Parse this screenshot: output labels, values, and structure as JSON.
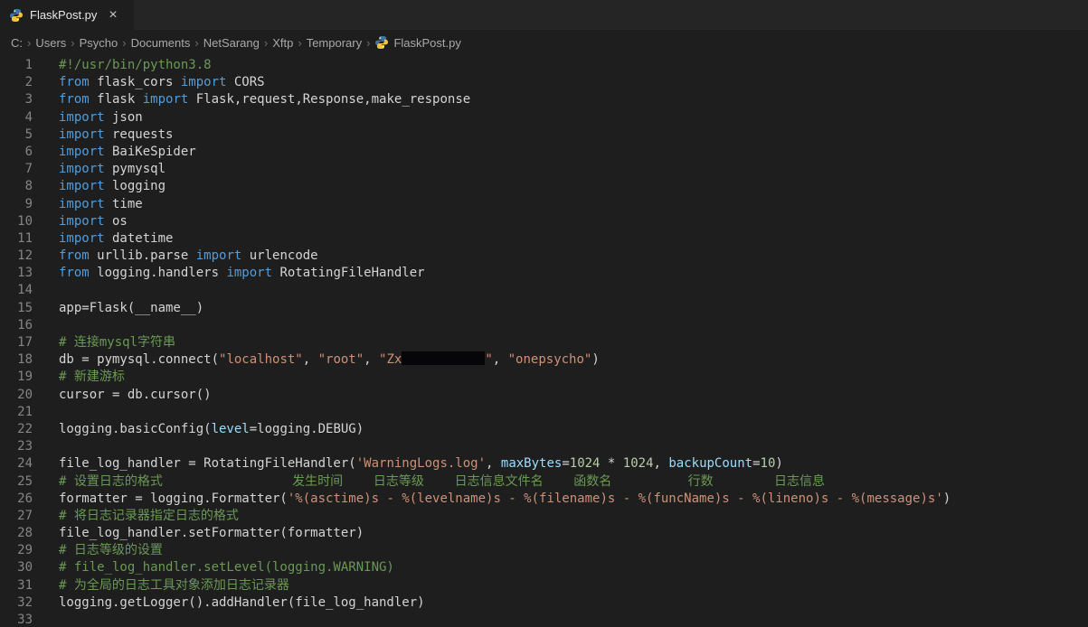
{
  "colors": {
    "editor_bg": "#1e1e1e",
    "tabbar_bg": "#252526",
    "tab_active_bg": "#1e1e1e",
    "tab_label": "#e7e7e7",
    "breadcrumb_text": "#a9a9a9",
    "line_number": "#858585",
    "plain": "#d4d4d4",
    "keyword": "#569cd6",
    "string": "#ce9178",
    "comment": "#6a9955",
    "number": "#b5cea8",
    "param": "#9cdcfe",
    "python_blue": "#3a74a6",
    "python_yellow": "#f0c33c",
    "redaction": "#060608"
  },
  "tab": {
    "label": "FlaskPost.py",
    "close": "×"
  },
  "breadcrumb": {
    "separator": "›",
    "items": [
      "C:",
      "Users",
      "Psycho",
      "Documents",
      "NetSarang",
      "Xftp",
      "Temporary"
    ],
    "file": "FlaskPost.py"
  },
  "editor": {
    "lines": [
      {
        "n": 1,
        "tokens": [
          [
            "cm",
            "#!/usr/bin/python3.8"
          ]
        ]
      },
      {
        "n": 2,
        "tokens": [
          [
            "kw",
            "from"
          ],
          [
            "pl",
            " flask_cors "
          ],
          [
            "kw",
            "import"
          ],
          [
            "pl",
            " CORS"
          ]
        ]
      },
      {
        "n": 3,
        "tokens": [
          [
            "kw",
            "from"
          ],
          [
            "pl",
            " flask "
          ],
          [
            "kw",
            "import"
          ],
          [
            "pl",
            " Flask,request,Response,make_response"
          ]
        ]
      },
      {
        "n": 4,
        "tokens": [
          [
            "kw",
            "import"
          ],
          [
            "pl",
            " json"
          ]
        ]
      },
      {
        "n": 5,
        "tokens": [
          [
            "kw",
            "import"
          ],
          [
            "pl",
            " requests"
          ]
        ]
      },
      {
        "n": 6,
        "tokens": [
          [
            "kw",
            "import"
          ],
          [
            "pl",
            " BaiKeSpider"
          ]
        ]
      },
      {
        "n": 7,
        "tokens": [
          [
            "kw",
            "import"
          ],
          [
            "pl",
            " pymysql"
          ]
        ]
      },
      {
        "n": 8,
        "tokens": [
          [
            "kw",
            "import"
          ],
          [
            "pl",
            " logging"
          ]
        ]
      },
      {
        "n": 9,
        "tokens": [
          [
            "kw",
            "import"
          ],
          [
            "pl",
            " time"
          ]
        ]
      },
      {
        "n": 10,
        "tokens": [
          [
            "kw",
            "import"
          ],
          [
            "pl",
            " os"
          ]
        ]
      },
      {
        "n": 11,
        "tokens": [
          [
            "kw",
            "import"
          ],
          [
            "pl",
            " datetime"
          ]
        ]
      },
      {
        "n": 12,
        "tokens": [
          [
            "kw",
            "from"
          ],
          [
            "pl",
            " urllib.parse "
          ],
          [
            "kw",
            "import"
          ],
          [
            "pl",
            " urlencode"
          ]
        ]
      },
      {
        "n": 13,
        "tokens": [
          [
            "kw",
            "from"
          ],
          [
            "pl",
            " logging.handlers "
          ],
          [
            "kw",
            "import"
          ],
          [
            "pl",
            " RotatingFileHandler"
          ]
        ]
      },
      {
        "n": 14,
        "tokens": []
      },
      {
        "n": 15,
        "tokens": [
          [
            "pl",
            "app=Flask(__name__)"
          ]
        ]
      },
      {
        "n": 16,
        "tokens": []
      },
      {
        "n": 17,
        "tokens": [
          [
            "cm",
            "# 连接mysql字符串"
          ]
        ]
      },
      {
        "n": 18,
        "tokens": [
          [
            "pl",
            "db = pymysql.connect("
          ],
          [
            "str",
            "\"localhost\""
          ],
          [
            "pl",
            ", "
          ],
          [
            "str",
            "\"root\""
          ],
          [
            "pl",
            ", "
          ],
          [
            "str",
            "\"Zx"
          ],
          [
            "redact",
            ""
          ],
          [
            "str",
            "\""
          ],
          [
            "pl",
            ", "
          ],
          [
            "str",
            "\"onepsycho\""
          ],
          [
            "pl",
            ")"
          ]
        ]
      },
      {
        "n": 19,
        "tokens": [
          [
            "cm",
            "# 新建游标"
          ]
        ]
      },
      {
        "n": 20,
        "tokens": [
          [
            "pl",
            "cursor = db.cursor()"
          ]
        ]
      },
      {
        "n": 21,
        "tokens": []
      },
      {
        "n": 22,
        "tokens": [
          [
            "pl",
            "logging.basicConfig("
          ],
          [
            "pm",
            "level"
          ],
          [
            "pl",
            "=logging.DEBUG)"
          ]
        ]
      },
      {
        "n": 23,
        "tokens": []
      },
      {
        "n": 24,
        "tokens": [
          [
            "pl",
            "file_log_handler = RotatingFileHandler("
          ],
          [
            "str",
            "'WarningLogs.log'"
          ],
          [
            "pl",
            ", "
          ],
          [
            "pm",
            "maxBytes"
          ],
          [
            "pl",
            "="
          ],
          [
            "num",
            "1024"
          ],
          [
            "pl",
            " * "
          ],
          [
            "num",
            "1024"
          ],
          [
            "pl",
            ", "
          ],
          [
            "pm",
            "backupCount"
          ],
          [
            "pl",
            "="
          ],
          [
            "num",
            "10"
          ],
          [
            "pl",
            ")"
          ]
        ]
      },
      {
        "n": 25,
        "tokens": [
          [
            "cm",
            "# 设置日志的格式                 发生时间    日志等级    日志信息文件名    函数名          行数        日志信息"
          ]
        ]
      },
      {
        "n": 26,
        "tokens": [
          [
            "pl",
            "formatter = logging.Formatter("
          ],
          [
            "str",
            "'%(asctime)s - %(levelname)s - %(filename)s - %(funcName)s - %(lineno)s - %(message)s'"
          ],
          [
            "pl",
            ")"
          ]
        ]
      },
      {
        "n": 27,
        "tokens": [
          [
            "cm",
            "# 将日志记录器指定日志的格式"
          ]
        ]
      },
      {
        "n": 28,
        "tokens": [
          [
            "pl",
            "file_log_handler.setFormatter(formatter)"
          ]
        ]
      },
      {
        "n": 29,
        "tokens": [
          [
            "cm",
            "# 日志等级的设置"
          ]
        ]
      },
      {
        "n": 30,
        "tokens": [
          [
            "cm",
            "# file_log_handler.setLevel(logging.WARNING)"
          ]
        ]
      },
      {
        "n": 31,
        "tokens": [
          [
            "cm",
            "# 为全局的日志工具对象添加日志记录器"
          ]
        ]
      },
      {
        "n": 32,
        "tokens": [
          [
            "pl",
            "logging.getLogger().addHandler(file_log_handler)"
          ]
        ]
      },
      {
        "n": 33,
        "tokens": []
      }
    ]
  }
}
